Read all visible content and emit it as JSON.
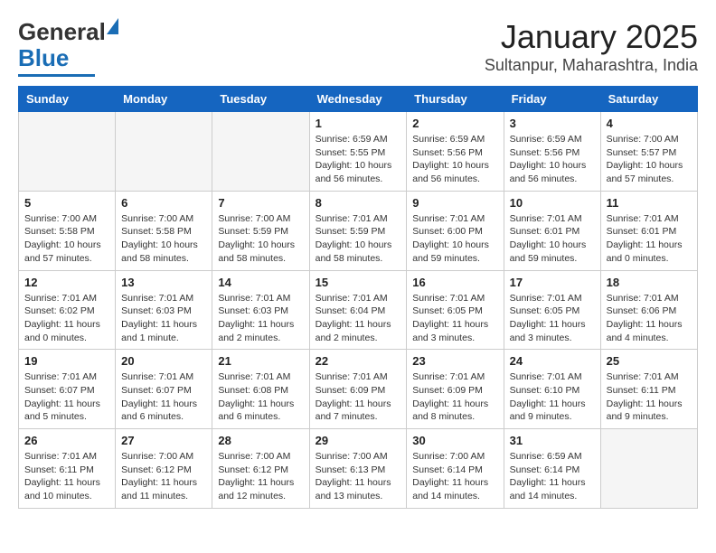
{
  "header": {
    "logo_line1": "General",
    "logo_line2": "Blue",
    "title": "January 2025",
    "subtitle": "Sultanpur, Maharashtra, India"
  },
  "columns": [
    "Sunday",
    "Monday",
    "Tuesday",
    "Wednesday",
    "Thursday",
    "Friday",
    "Saturday"
  ],
  "weeks": [
    [
      {
        "day": "",
        "info": ""
      },
      {
        "day": "",
        "info": ""
      },
      {
        "day": "",
        "info": ""
      },
      {
        "day": "1",
        "info": "Sunrise: 6:59 AM\nSunset: 5:55 PM\nDaylight: 10 hours and 56 minutes."
      },
      {
        "day": "2",
        "info": "Sunrise: 6:59 AM\nSunset: 5:56 PM\nDaylight: 10 hours and 56 minutes."
      },
      {
        "day": "3",
        "info": "Sunrise: 6:59 AM\nSunset: 5:56 PM\nDaylight: 10 hours and 56 minutes."
      },
      {
        "day": "4",
        "info": "Sunrise: 7:00 AM\nSunset: 5:57 PM\nDaylight: 10 hours and 57 minutes."
      }
    ],
    [
      {
        "day": "5",
        "info": "Sunrise: 7:00 AM\nSunset: 5:58 PM\nDaylight: 10 hours and 57 minutes."
      },
      {
        "day": "6",
        "info": "Sunrise: 7:00 AM\nSunset: 5:58 PM\nDaylight: 10 hours and 58 minutes."
      },
      {
        "day": "7",
        "info": "Sunrise: 7:00 AM\nSunset: 5:59 PM\nDaylight: 10 hours and 58 minutes."
      },
      {
        "day": "8",
        "info": "Sunrise: 7:01 AM\nSunset: 5:59 PM\nDaylight: 10 hours and 58 minutes."
      },
      {
        "day": "9",
        "info": "Sunrise: 7:01 AM\nSunset: 6:00 PM\nDaylight: 10 hours and 59 minutes."
      },
      {
        "day": "10",
        "info": "Sunrise: 7:01 AM\nSunset: 6:01 PM\nDaylight: 10 hours and 59 minutes."
      },
      {
        "day": "11",
        "info": "Sunrise: 7:01 AM\nSunset: 6:01 PM\nDaylight: 11 hours and 0 minutes."
      }
    ],
    [
      {
        "day": "12",
        "info": "Sunrise: 7:01 AM\nSunset: 6:02 PM\nDaylight: 11 hours and 0 minutes."
      },
      {
        "day": "13",
        "info": "Sunrise: 7:01 AM\nSunset: 6:03 PM\nDaylight: 11 hours and 1 minute."
      },
      {
        "day": "14",
        "info": "Sunrise: 7:01 AM\nSunset: 6:03 PM\nDaylight: 11 hours and 2 minutes."
      },
      {
        "day": "15",
        "info": "Sunrise: 7:01 AM\nSunset: 6:04 PM\nDaylight: 11 hours and 2 minutes."
      },
      {
        "day": "16",
        "info": "Sunrise: 7:01 AM\nSunset: 6:05 PM\nDaylight: 11 hours and 3 minutes."
      },
      {
        "day": "17",
        "info": "Sunrise: 7:01 AM\nSunset: 6:05 PM\nDaylight: 11 hours and 3 minutes."
      },
      {
        "day": "18",
        "info": "Sunrise: 7:01 AM\nSunset: 6:06 PM\nDaylight: 11 hours and 4 minutes."
      }
    ],
    [
      {
        "day": "19",
        "info": "Sunrise: 7:01 AM\nSunset: 6:07 PM\nDaylight: 11 hours and 5 minutes."
      },
      {
        "day": "20",
        "info": "Sunrise: 7:01 AM\nSunset: 6:07 PM\nDaylight: 11 hours and 6 minutes."
      },
      {
        "day": "21",
        "info": "Sunrise: 7:01 AM\nSunset: 6:08 PM\nDaylight: 11 hours and 6 minutes."
      },
      {
        "day": "22",
        "info": "Sunrise: 7:01 AM\nSunset: 6:09 PM\nDaylight: 11 hours and 7 minutes."
      },
      {
        "day": "23",
        "info": "Sunrise: 7:01 AM\nSunset: 6:09 PM\nDaylight: 11 hours and 8 minutes."
      },
      {
        "day": "24",
        "info": "Sunrise: 7:01 AM\nSunset: 6:10 PM\nDaylight: 11 hours and 9 minutes."
      },
      {
        "day": "25",
        "info": "Sunrise: 7:01 AM\nSunset: 6:11 PM\nDaylight: 11 hours and 9 minutes."
      }
    ],
    [
      {
        "day": "26",
        "info": "Sunrise: 7:01 AM\nSunset: 6:11 PM\nDaylight: 11 hours and 10 minutes."
      },
      {
        "day": "27",
        "info": "Sunrise: 7:00 AM\nSunset: 6:12 PM\nDaylight: 11 hours and 11 minutes."
      },
      {
        "day": "28",
        "info": "Sunrise: 7:00 AM\nSunset: 6:12 PM\nDaylight: 11 hours and 12 minutes."
      },
      {
        "day": "29",
        "info": "Sunrise: 7:00 AM\nSunset: 6:13 PM\nDaylight: 11 hours and 13 minutes."
      },
      {
        "day": "30",
        "info": "Sunrise: 7:00 AM\nSunset: 6:14 PM\nDaylight: 11 hours and 14 minutes."
      },
      {
        "day": "31",
        "info": "Sunrise: 6:59 AM\nSunset: 6:14 PM\nDaylight: 11 hours and 14 minutes."
      },
      {
        "day": "",
        "info": ""
      }
    ]
  ]
}
